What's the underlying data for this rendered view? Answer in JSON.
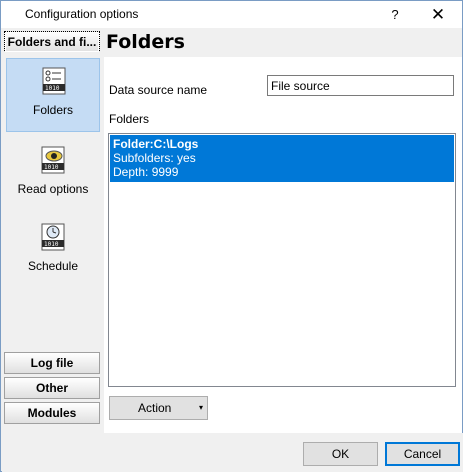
{
  "window": {
    "title": "Configuration options",
    "help_glyph": "?",
    "close_glyph": "✕"
  },
  "sidebar": {
    "active_group": "Folders and fi...",
    "items": [
      {
        "label": "Folders",
        "icon": "folders-icon",
        "selected": true
      },
      {
        "label": "Read options",
        "icon": "read-options-icon",
        "selected": false
      },
      {
        "label": "Schedule",
        "icon": "schedule-icon",
        "selected": false
      }
    ],
    "groups": [
      {
        "label": "Log file"
      },
      {
        "label": "Other"
      },
      {
        "label": "Modules"
      }
    ]
  },
  "main": {
    "heading": "Folders",
    "data_source_label": "Data source name",
    "data_source_value": "File source",
    "folders_label": "Folders",
    "folder_entries": [
      {
        "folder": "Folder:C:\\Logs",
        "subfolders": "Subfolders: yes",
        "depth": "Depth: 9999"
      }
    ],
    "action_button": "Action",
    "action_arrow": "▾"
  },
  "footer": {
    "ok_label": "OK",
    "cancel_label": "Cancel"
  },
  "colors": {
    "selection": "#0078d7",
    "nav_selected": "#c5dcf4"
  }
}
